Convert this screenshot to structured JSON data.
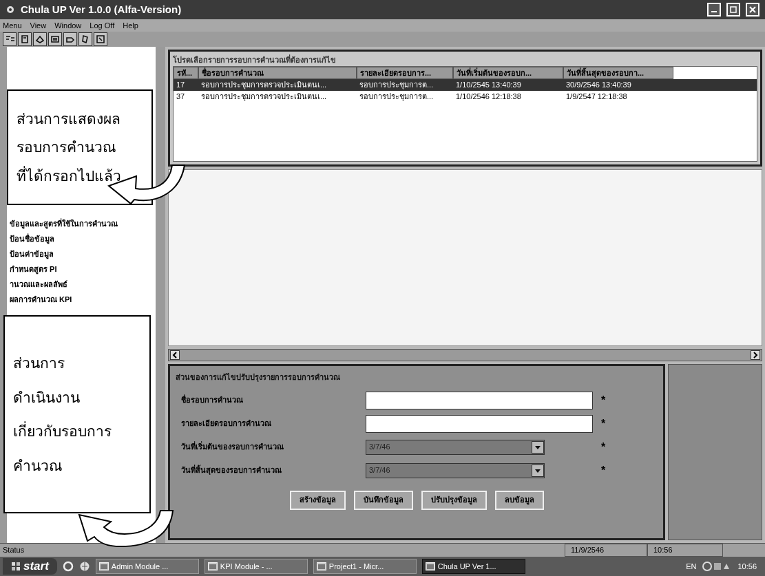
{
  "window": {
    "title": "Chula UP Ver 1.0.0 (Alfa-Version)"
  },
  "menu": [
    "Menu",
    "View",
    "Window",
    "Log Off",
    "Help"
  ],
  "sidebar": {
    "items": [
      "ข้อมูลและสูตรที่ใช้ในการคำนวณ",
      "ป้อนชื่อข้อมูล",
      "ป้อนค่าข้อมูล",
      "กำหนดสูตร PI",
      "านวณและผลลัพธ์",
      "ผลการคำนวณ KPI"
    ]
  },
  "list_panel": {
    "title": "โปรดเลือกรายการรอบการคำนวณที่ต้องการแก้ไข",
    "columns": [
      "รหั...",
      "ชื่อรอบการคำนวณ",
      "รายละเอียดรอบการ...",
      "วันที่เริ่มต้นของรอบก...",
      "วันที่สิ้นสุดของรอบกา..."
    ],
    "rows": [
      {
        "selected": true,
        "cells": [
          "17",
          "รอบการประชุมการตรวจประเมินตนเ...",
          "รอบการประชุมการต...",
          "1/10/2545 13:40:39",
          "30/9/2546 13:40:39"
        ]
      },
      {
        "selected": false,
        "cells": [
          "37",
          "รอบการประชุมการตรวจประเมินตนเ...",
          "รอบการประชุมการต...",
          "1/10/2546 12:18:38",
          "1/9/2547 12:18:38"
        ]
      }
    ]
  },
  "form": {
    "title": "ส่วนของการแก้ไขปรับปรุงรายการรอบการคำนวณ",
    "fields": [
      {
        "kind": "text",
        "label": "ชื่อรอบการคำนวณ",
        "mark": "*"
      },
      {
        "kind": "text",
        "label": "รายละเอียดรอบการคำนวณ",
        "mark": "*"
      },
      {
        "kind": "combo",
        "label": "วันที่เริ่มต้นของรอบการคำนวณ",
        "value": "3/7/46",
        "mark": "*"
      },
      {
        "kind": "combo",
        "label": "วันที่สิ้นสุดของรอบการคำนวณ",
        "value": "3/7/46",
        "mark": "*"
      }
    ],
    "buttons": [
      "สร้างข้อมูล",
      "บันทึกข้อมูล",
      "ปรับปรุงข้อมูล",
      "ลบข้อมูล"
    ]
  },
  "status_bar": {
    "label": "Status",
    "date": "11/9/2546",
    "time": "10:56"
  },
  "taskbar": {
    "start": "start",
    "tasks": [
      {
        "label": "Admin Module ...",
        "selected": false
      },
      {
        "label": "KPI Module - ...",
        "selected": false
      },
      {
        "label": "Project1 - Micr...",
        "selected": false
      },
      {
        "label": "Chula UP Ver 1...",
        "selected": true
      }
    ],
    "language": "EN",
    "clock": "10:56"
  },
  "callouts": [
    {
      "lines": [
        "ส่วนการแสดงผล",
        "รอบการคำนวณ",
        "ที่ได้กรอกไปแล้ว"
      ]
    },
    {
      "lines": [
        "ส่วนการ",
        "ดำเนินงาน",
        "เกี่ยวกับรอบการ",
        "คำนวณ"
      ]
    }
  ]
}
